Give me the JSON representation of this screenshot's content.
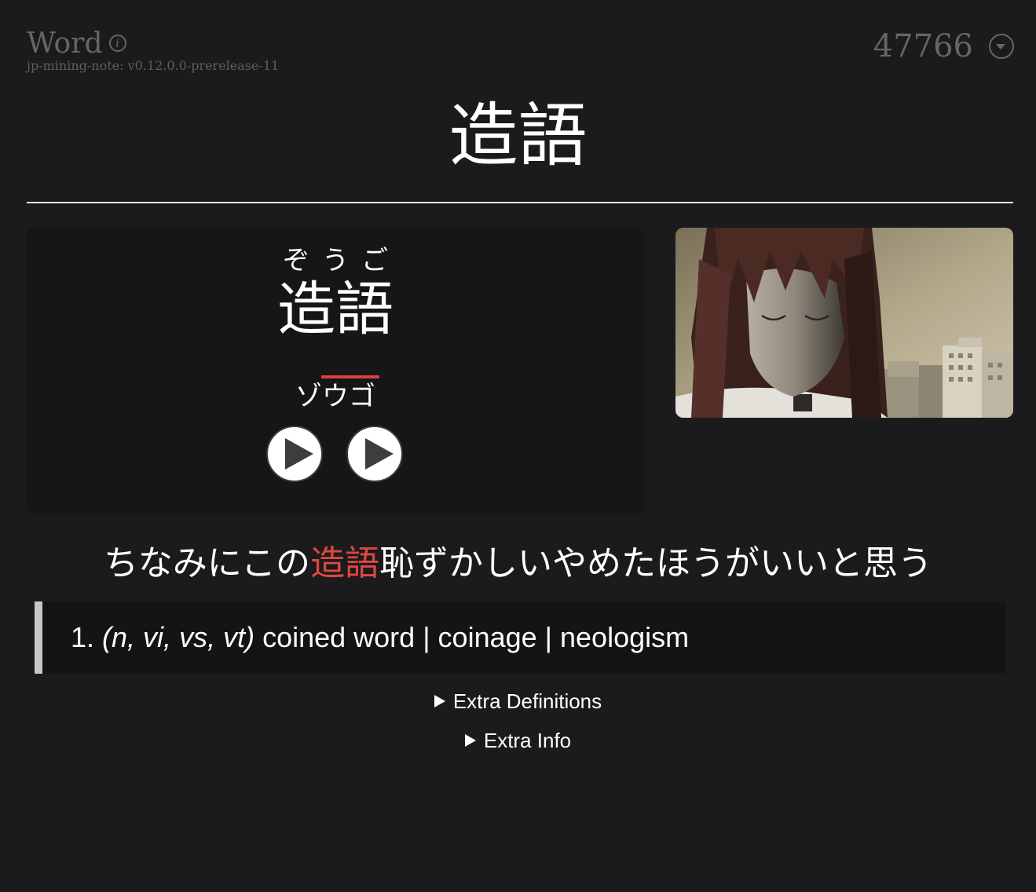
{
  "header": {
    "card_type": "Word",
    "version": "jp-mining-note: v0.12.0.0-prerelease-11",
    "card_id": "47766"
  },
  "word": {
    "main": "造語",
    "furigana": "ぞうご",
    "kanji": "造語",
    "katakana": "ゾウゴ"
  },
  "audio": {
    "buttons": [
      {
        "icon": "play-icon"
      },
      {
        "icon": "play-icon"
      }
    ]
  },
  "screenshot": {
    "description_name": "anime-screenshot"
  },
  "sentence": {
    "before": "ちなみにこの",
    "highlight": "造語",
    "after": "恥ずかしいやめたほうがいいと思う"
  },
  "definition": {
    "number": "1.",
    "tags": "(n, vi, vs, vt)",
    "text": "coined word | coinage | neologism"
  },
  "extra": {
    "definitions_label": "Extra Definitions",
    "info_label": "Extra Info"
  },
  "colors": {
    "background": "#1b1b1d",
    "accent_red": "#e0483f",
    "muted": "#666669"
  }
}
